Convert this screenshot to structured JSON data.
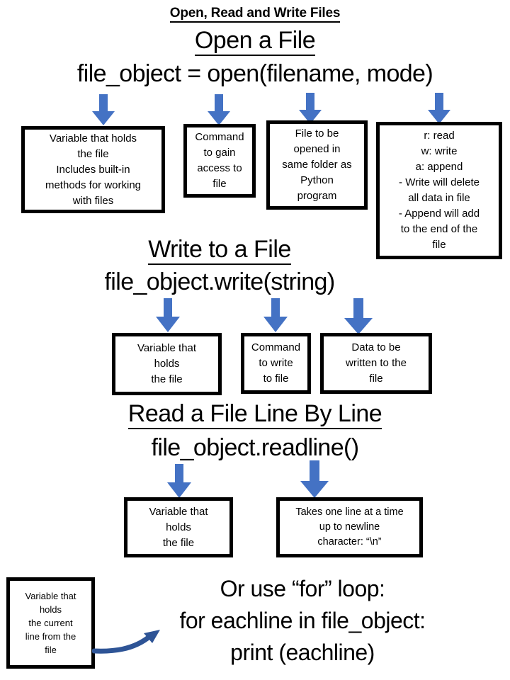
{
  "page": {
    "title": "Open, Read and Write Files",
    "background": "#ffffff",
    "text_color": "#000000",
    "arrow_color": "#4472C4",
    "curve_arrow_color": "#2E5496",
    "box_border_color": "#000000"
  },
  "sections": {
    "open": {
      "heading": "Open a File",
      "code": "file_object = open(filename, mode)",
      "boxes": [
        {
          "name": "variable-holds-file",
          "lines": [
            "Variable that holds",
            "the file",
            "Includes built-in",
            "methods for working",
            "with files"
          ]
        },
        {
          "name": "command-to-gain-access",
          "lines": [
            "Command",
            "to gain",
            "access to",
            "file"
          ]
        },
        {
          "name": "file-to-be-opened",
          "lines": [
            "File to be",
            "opened in",
            "same folder as",
            "Python",
            "program"
          ]
        },
        {
          "name": "mode-options",
          "lines": [
            "r: read",
            "w: write",
            "a: append",
            "- Write will delete",
            "all data in file",
            "- Append will add",
            "to the end of the",
            "file"
          ]
        }
      ]
    },
    "write": {
      "heading": "Write to a File",
      "code": "file_object.write(string)",
      "boxes": [
        {
          "name": "variable-holds-file",
          "lines": [
            "Variable that",
            "holds",
            "the file"
          ]
        },
        {
          "name": "command-to-write",
          "lines": [
            "Command",
            "to write",
            "to file"
          ]
        },
        {
          "name": "data-to-be-written",
          "lines": [
            "Data to be",
            "written to the",
            "file"
          ]
        }
      ]
    },
    "read": {
      "heading": "Read a File Line By Line",
      "code": "file_object.readline()",
      "boxes": [
        {
          "name": "variable-holds-file",
          "lines": [
            "Variable that",
            "holds",
            "the file"
          ]
        },
        {
          "name": "takes-one-line",
          "lines": [
            "Takes one line at a time",
            "up to newline",
            "character: “\\n”"
          ]
        }
      ]
    },
    "forloop": {
      "lines": [
        "Or use “for” loop:",
        "for eachline in file_object:",
        "print (eachline)"
      ],
      "box": {
        "name": "variable-holds-current-line",
        "lines": [
          "Variable that",
          "holds",
          "the current",
          "line from the",
          "file"
        ]
      }
    }
  }
}
